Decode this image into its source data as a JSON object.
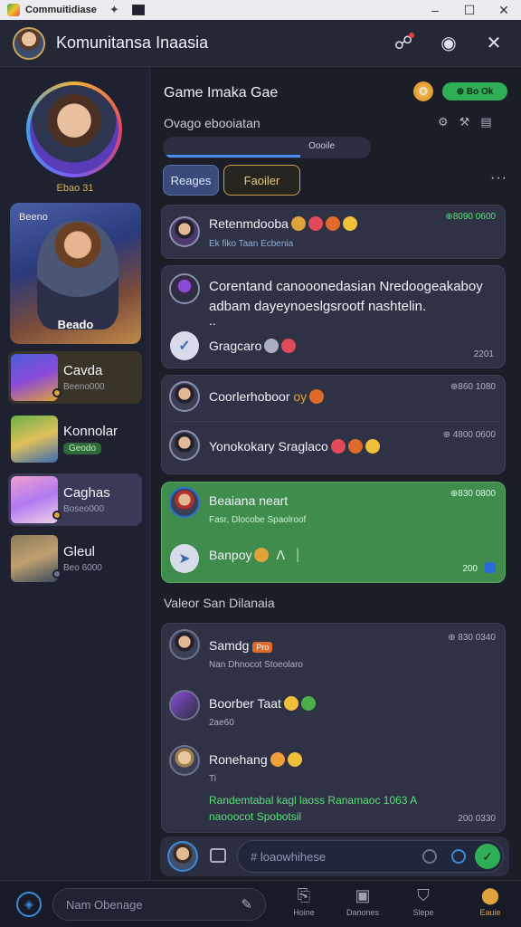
{
  "titlebar": {
    "title": "Commuitidiase",
    "controls": [
      "–",
      "☐",
      "✕"
    ]
  },
  "header": {
    "title": "Komunitansa Inaasia"
  },
  "profile": {
    "name": "Ebao 31"
  },
  "hero": {
    "top_label": "Beeno",
    "bottom_label": "Beado"
  },
  "characters": [
    {
      "name": "Cavda",
      "sub": "Beeno000",
      "sub_green": false
    },
    {
      "name": "Konnolar",
      "sub": "Geodo",
      "sub_green": true
    },
    {
      "name": "Caghas",
      "sub": "Boseo000",
      "sub_green": false
    },
    {
      "name": "Gleul",
      "sub": "Beo 6000",
      "sub_green": false
    }
  ],
  "main": {
    "title": "Game Imaka Gae",
    "pill": "⊕ Bo Ok",
    "subtitle": "Ovago ebooiatan",
    "progress": {
      "label": "Oooile",
      "value": 0.66
    },
    "tabs": {
      "active": "Reages",
      "outline": "Faoiler"
    },
    "more": "···"
  },
  "messages": [
    {
      "title": "Retenmdooba",
      "sub": "Ek fiko Taan Ecbenia",
      "time": "⊕8090 0600"
    },
    {
      "title": "Corentand canooonedasian Nredoogeakaboy",
      "line2": "adbam dayeynoeslgsrootf nashtelin.",
      "line3": "..",
      "footer": "Gragcaro",
      "time": "2201"
    },
    {
      "title": "Coorlerhoboor",
      "tag": "oy",
      "time": "⊕860 1080"
    },
    {
      "title": "Yonokokary Sraglaco",
      "time": "⊕ 4800 0600"
    },
    {
      "title": "Beaiana neart",
      "sub": "Fasr, Dlocobe Spaolroof",
      "footer": "Banpoy",
      "time": "⊕830 0800",
      "time2": "200"
    },
    {
      "section": "Valeor San Dilanaia"
    },
    {
      "title": "Samdg",
      "badge": "Pro",
      "sub": "Nan Dhnocot Stoeolaro",
      "time": "⊕ 830 0340"
    },
    {
      "title": "Boorber Taat",
      "sub": "2ae60",
      "time": ""
    },
    {
      "title": "Ronehang",
      "sub": "Ti",
      "line2": "Randemtabal kagl laoss Ranamaoc 1063 A",
      "line3": "naooocot Spobotsil",
      "time": "200 0330"
    }
  ],
  "composer": {
    "placeholder": "# loaowhihese"
  },
  "bottom": {
    "input_placeholder": "Nam Obenage",
    "tabs": [
      {
        "label": "Hoine",
        "icon": "⎘"
      },
      {
        "label": "Danones",
        "icon": "▣"
      },
      {
        "label": "Slepe",
        "icon": "⛉"
      },
      {
        "label": "Eauie",
        "icon": "⬤"
      }
    ]
  },
  "colors": {
    "accent": "#3a8ad8",
    "green": "#2fae58",
    "gold": "#e0a23a",
    "panel": "#2e3244"
  }
}
